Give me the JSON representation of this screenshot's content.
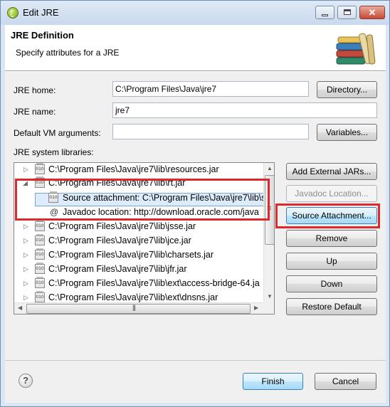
{
  "window": {
    "title": "Edit JRE",
    "close_glyph": "✕"
  },
  "header": {
    "title": "JRE Definition",
    "description": "Specify attributes for a JRE",
    "icon": "library-books-icon"
  },
  "form": {
    "jre_home_label": "JRE home:",
    "jre_home_value": "C:\\Program Files\\Java\\jre7",
    "directory_button": "Directory...",
    "jre_name_label": "JRE name:",
    "jre_name_value": "jre7",
    "vm_args_label": "Default VM arguments:",
    "vm_args_value": "",
    "variables_button": "Variables...",
    "libraries_label": "JRE system libraries:"
  },
  "libraries": [
    {
      "path": "C:\\Program Files\\Java\\jre7\\lib\\resources.jar",
      "expanded": false
    },
    {
      "path": "C:\\Program Files\\Java\\jre7\\lib\\rt.jar",
      "expanded": true,
      "children": [
        {
          "text": "Source attachment: C:\\Program Files\\Java\\jre7\\lib\\s",
          "icon": "source-attachment-icon",
          "selected": true
        },
        {
          "text": "Javadoc location: http://download.oracle.com/java",
          "icon": "at-sign-icon",
          "selected": false
        }
      ]
    },
    {
      "path": "C:\\Program Files\\Java\\jre7\\lib\\jsse.jar",
      "expanded": false
    },
    {
      "path": "C:\\Program Files\\Java\\jre7\\lib\\jce.jar",
      "expanded": false
    },
    {
      "path": "C:\\Program Files\\Java\\jre7\\lib\\charsets.jar",
      "expanded": false
    },
    {
      "path": "C:\\Program Files\\Java\\jre7\\lib\\jfr.jar",
      "expanded": false
    },
    {
      "path": "C:\\Program Files\\Java\\jre7\\lib\\ext\\access-bridge-64.ja",
      "expanded": false
    },
    {
      "path": "C:\\Program Files\\Java\\jre7\\lib\\ext\\dnsns.jar",
      "expanded": false
    }
  ],
  "jar_icon_text": "010",
  "side_buttons": {
    "add_external_jars": "Add External JARs...",
    "javadoc_location": "Javadoc Location...",
    "source_attachment": "Source Attachment...",
    "remove": "Remove",
    "up": "Up",
    "down": "Down",
    "restore_default": "Restore Default"
  },
  "footer": {
    "help": "?",
    "finish": "Finish",
    "cancel": "Cancel"
  },
  "colors": {
    "highlight_box": "#e0292c",
    "selection": "#dcecfc"
  }
}
